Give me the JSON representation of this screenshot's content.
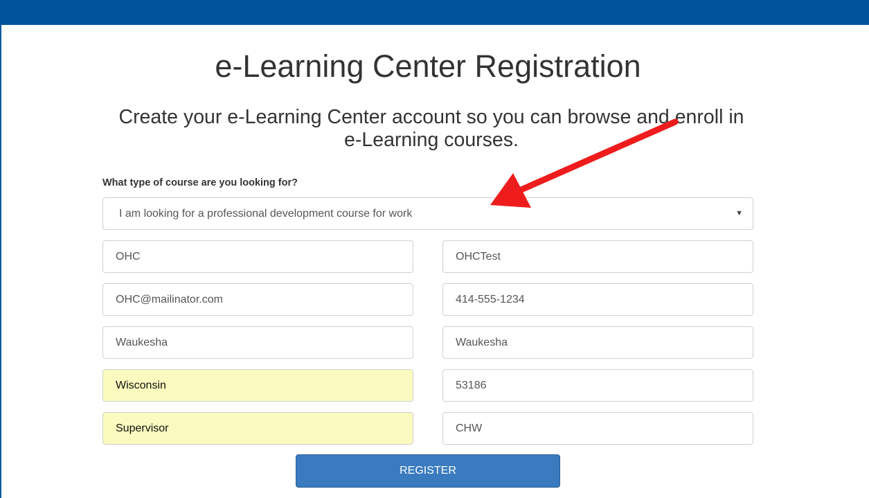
{
  "page": {
    "title": "e-Learning Center Registration",
    "subtitle": "Create your e-Learning Center account so you can browse and enroll in e-Learning courses."
  },
  "form": {
    "course_type_label": "What type of course are you looking for?",
    "course_type_selected": "I am looking for a professional development course for work",
    "fields": {
      "first_name": "OHC",
      "last_name": "OHCTest",
      "email": "OHC@mailinator.com",
      "phone": "414-555-1234",
      "city": "Waukesha",
      "county": "Waukesha",
      "state": "Wisconsin",
      "zip": "53186",
      "job_title": "Supervisor",
      "organization": "CHW"
    },
    "register_label": "REGISTER"
  },
  "colors": {
    "header_bar": "#00539b",
    "button": "#3a7bbf",
    "autofill": "#fbfbbf",
    "annotation_arrow": "#ee1c1c"
  },
  "icons": {
    "select_caret": "caret-down-icon",
    "annotation": "red-arrow-annotation"
  }
}
